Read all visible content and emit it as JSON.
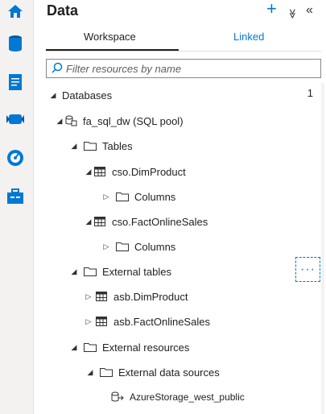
{
  "panel": {
    "title": "Data"
  },
  "header_actions": {
    "add": "+",
    "collapse_all": "≫",
    "hide": "«"
  },
  "tabs": [
    {
      "label": "Workspace",
      "selected": true
    },
    {
      "label": "Linked",
      "selected": false
    }
  ],
  "filter": {
    "placeholder": "Filter resources by name",
    "value": ""
  },
  "tree": {
    "databases": {
      "label": "Databases",
      "count": "1"
    },
    "sql_pool": "fa_sql_dw (SQL pool)",
    "tables": "Tables",
    "dim_product": "cso.DimProduct",
    "dim_product_columns": "Columns",
    "fact_online_sales": "cso.FactOnlineSales",
    "fact_online_sales_columns": "Columns",
    "external_tables": "External tables",
    "asb_dim_product": "asb.DimProduct",
    "asb_fact_online_sales": "asb.FactOnlineSales",
    "external_resources": "External resources",
    "external_data_sources": "External data sources",
    "azure_storage": "AzureStorage_west_public"
  },
  "more_actions": "···",
  "colors": {
    "accent": "#0078d4",
    "rail": "#f3f2f1"
  }
}
